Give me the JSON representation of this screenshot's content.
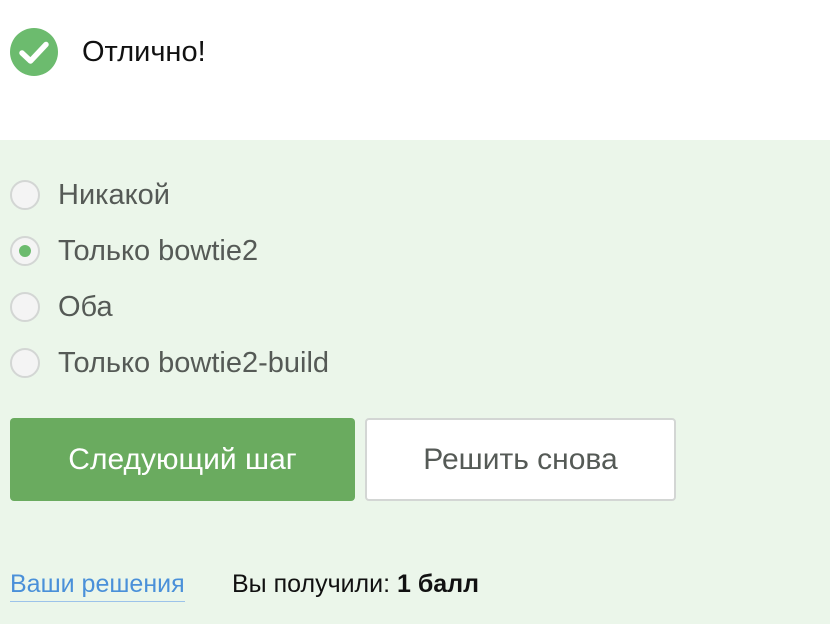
{
  "feedback": {
    "icon": "check-circle-icon",
    "text": "Отлично!",
    "color": "#6cbb6e"
  },
  "options": [
    {
      "label": "Никакой",
      "checked": false
    },
    {
      "label": "Только bowtie2",
      "checked": true
    },
    {
      "label": "Оба",
      "checked": false
    },
    {
      "label": "Только bowtie2-build",
      "checked": false
    }
  ],
  "buttons": {
    "next_label": "Следующий шаг",
    "retry_label": "Решить снова"
  },
  "footer": {
    "solutions_link": "Ваши решения",
    "score_prefix": "Вы получили: ",
    "score_value": "1 балл"
  },
  "colors": {
    "panel_bg": "#ebf6ea",
    "accent_green": "#6aab5f",
    "link_blue": "#4a90d9"
  }
}
